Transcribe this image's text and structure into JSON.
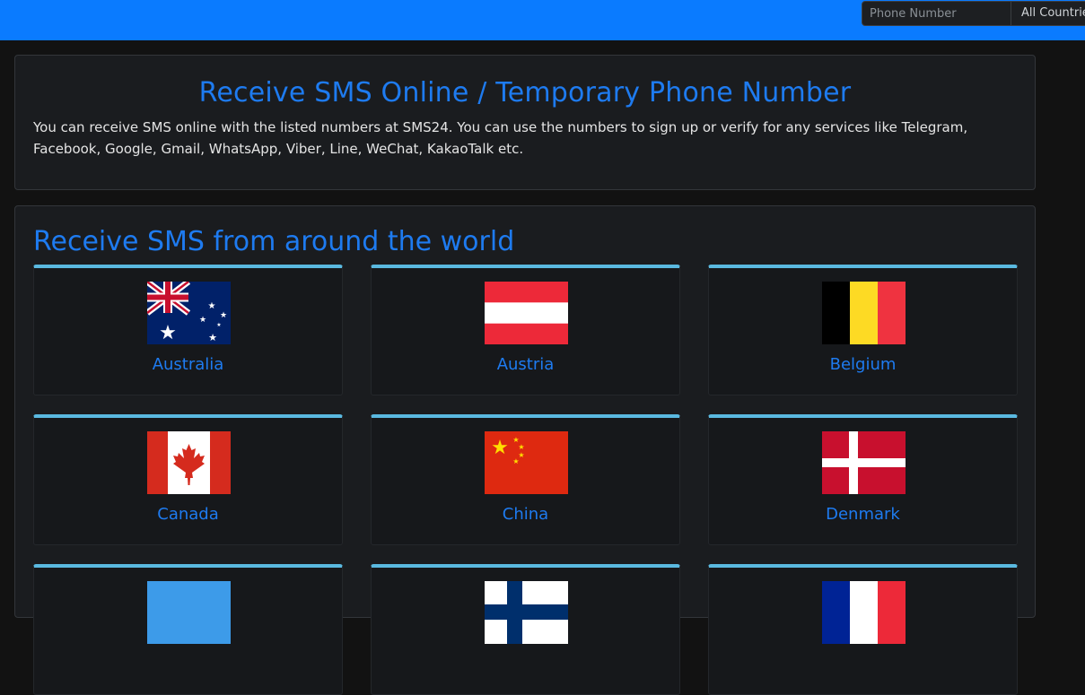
{
  "header": {
    "search_placeholder": "Phone Number",
    "country_select_value": "All Countries"
  },
  "intro": {
    "title": "Receive SMS Online / Temporary Phone Number",
    "description": "You can receive SMS online with the listed numbers at SMS24. You can use the numbers to sign up or verify for any services like Telegram, Facebook, Google, Gmail, WhatsApp, Viber, Line, WeChat, KakaoTalk etc."
  },
  "world": {
    "title": "Receive SMS from around the world"
  },
  "countries": [
    {
      "name": "Australia",
      "flag_icon": "australia-flag-icon"
    },
    {
      "name": "Austria",
      "flag_icon": "austria-flag-icon"
    },
    {
      "name": "Belgium",
      "flag_icon": "belgium-flag-icon"
    },
    {
      "name": "Canada",
      "flag_icon": "canada-flag-icon"
    },
    {
      "name": "China",
      "flag_icon": "china-flag-icon"
    },
    {
      "name": "Denmark",
      "flag_icon": "denmark-flag-icon"
    },
    {
      "name": "",
      "flag_icon": "blue-flag-icon"
    },
    {
      "name": "",
      "flag_icon": "blue-cross-flag-icon"
    },
    {
      "name": "",
      "flag_icon": "tricolor-flag-icon"
    }
  ],
  "colors": {
    "header_bg": "#0a7bff",
    "accent_text": "#1e7bf0",
    "card_top_border": "#5ab9e0",
    "page_bg": "#121212"
  }
}
